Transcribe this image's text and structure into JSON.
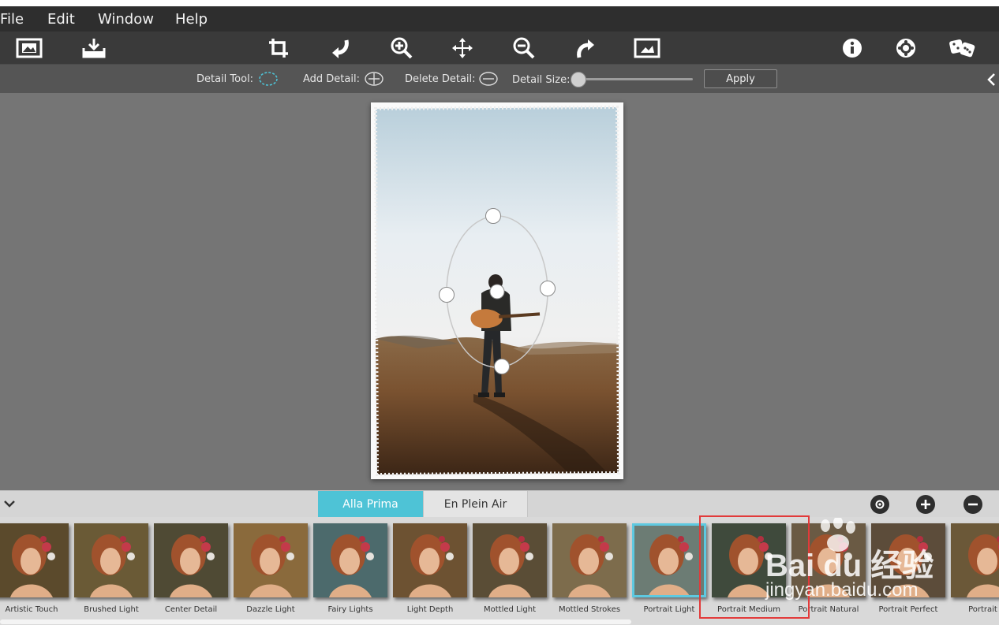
{
  "menu": [
    {
      "label": "File"
    },
    {
      "label": "Edit"
    },
    {
      "label": "Window"
    },
    {
      "label": "Help"
    }
  ],
  "toolbar": {
    "icons": [
      "open-image-icon",
      "save-image-icon",
      "crop-icon",
      "undo-icon",
      "zoom-in-icon",
      "pan-icon",
      "zoom-out-icon",
      "redo-icon",
      "compare-icon",
      "info-icon",
      "settings-icon",
      "random-dice-icon"
    ]
  },
  "detail_bar": {
    "detail_tool_label": "Detail Tool:",
    "add_detail_label": "Add Detail:",
    "delete_detail_label": "Delete Detail:",
    "detail_size_label": "Detail Size:",
    "apply_label": "Apply",
    "detail_size_value": 0
  },
  "styles_bar": {
    "tabs": [
      {
        "label": "Alla Prima",
        "active": true
      },
      {
        "label": "En Plein Air",
        "active": false
      }
    ]
  },
  "presets": [
    {
      "label": "Artistic Touch"
    },
    {
      "label": "Brushed Light"
    },
    {
      "label": "Center Detail"
    },
    {
      "label": "Dazzle Light"
    },
    {
      "label": "Fairy Lights"
    },
    {
      "label": "Light Depth"
    },
    {
      "label": "Mottled Light"
    },
    {
      "label": "Mottled Strokes"
    },
    {
      "label": "Portrait Light",
      "selected": true
    },
    {
      "label": "Portrait Medium"
    },
    {
      "label": "Portrait Natural"
    },
    {
      "label": "Portrait Perfect"
    },
    {
      "label": "Portrait W"
    }
  ],
  "watermark": {
    "brand": "Bai du 经验",
    "url": "jingyan.baidu.com"
  },
  "colors": {
    "accent": "#4ec3d6",
    "highlight_box": "#e23a3a"
  }
}
